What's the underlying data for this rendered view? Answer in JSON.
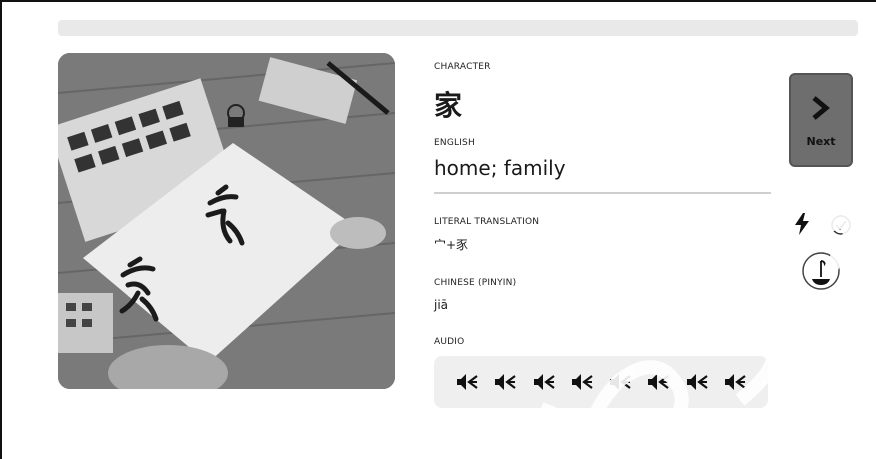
{
  "progress": {
    "fraction": 0.0
  },
  "photo": {
    "alt_icon": "calligraphy-photo"
  },
  "character": {
    "label": "CHARACTER",
    "value": "家"
  },
  "english": {
    "label": "ENGLISH",
    "value": "home; family"
  },
  "literal": {
    "label": "LITERAL TRANSLATION",
    "value": "宀+豕"
  },
  "pinyin": {
    "label": "CHINESE (PINYIN)",
    "value": "jiā"
  },
  "audio": {
    "label": "AUDIO",
    "buttons": [
      "speaker-icon",
      "speaker-icon",
      "speaker-icon",
      "speaker-icon",
      "speaker-icon",
      "speaker-icon",
      "speaker-icon",
      "speaker-icon"
    ]
  },
  "next": {
    "label": "Next"
  },
  "side_icons": [
    "bolt-icon",
    "check-icon",
    "tea-icon"
  ]
}
